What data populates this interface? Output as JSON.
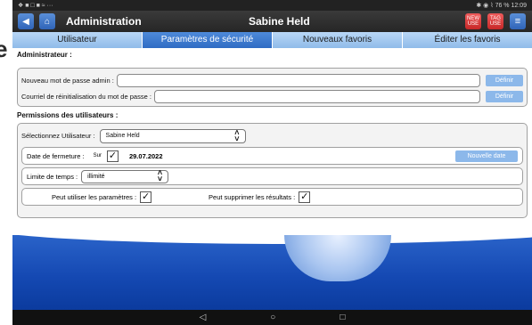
{
  "left_strip_char": "e",
  "statusbar": {
    "left": "❖ ■ □ ■ ≈ ···",
    "right": "✱ ◉ ⌇ 76 % 12:09"
  },
  "appbar": {
    "title": "Administration",
    "user": "Sabine Held",
    "icon1_label": "NEW\nUSE",
    "icon2_label": "TAG\nUSE"
  },
  "tabs": [
    {
      "label": "Utilisateur",
      "active": false
    },
    {
      "label": "Paramètres de sécurité",
      "active": true
    },
    {
      "label": "Nouveaux favoris",
      "active": false
    },
    {
      "label": "Éditer les favoris",
      "active": false
    }
  ],
  "admin": {
    "title": "Administrateur :",
    "new_password_label": "Nouveau mot de passe admin :",
    "reset_email_label": "Courriel de réinitialisation du mot de passe :",
    "define_label": "Définir"
  },
  "permissions": {
    "title": "Permissions des utilisateurs :",
    "select_user_label": "Sélectionnez Utilisateur :",
    "selected_user": "Sabine Held",
    "closing_date_label": "Date de fermeture :",
    "closing_sur": "Sur",
    "closing_date": "29.07.2022",
    "new_date_label": "Nouvelle date",
    "time_limit_label": "Limite de temps :",
    "time_limit_value": "illimité",
    "can_use_settings_label": "Peut utiliser les paramètres :",
    "can_delete_results_label": "Peut supprimer les résultats :"
  },
  "checks": {
    "closing": "✓",
    "settings": "✓",
    "delete": "✓"
  },
  "nav": {
    "back": "◁",
    "home": "○",
    "recent": "□"
  }
}
